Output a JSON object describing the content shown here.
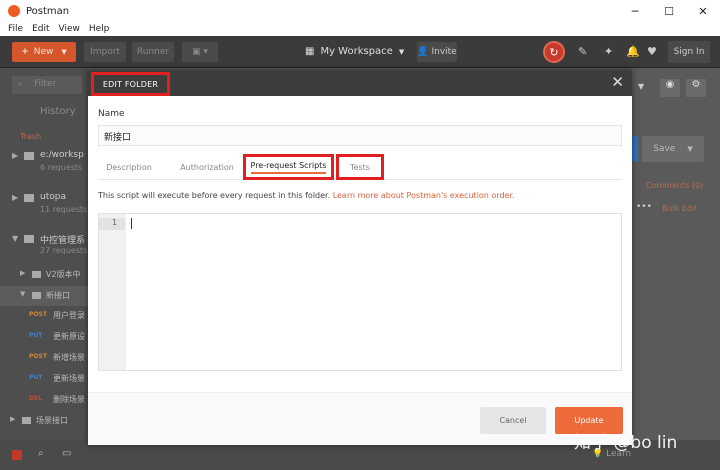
{
  "window": {
    "title": "Postman",
    "minimize": "─",
    "maximize": "☐",
    "close": "✕"
  },
  "menu": [
    "File",
    "Edit",
    "View",
    "Help"
  ],
  "toolbar": {
    "new_label": "New",
    "import_label": "Import",
    "runner_label": "Runner",
    "workspace_label": "My Workspace",
    "invite_label": "Invite",
    "signin_label": "Sign In"
  },
  "sidebar": {
    "filter_placeholder": "Filter",
    "history_tab": "History",
    "trash": "Trash",
    "collections": [
      {
        "name": "e:/worksp",
        "count": "6 requests"
      },
      {
        "name": "utopa",
        "count": "11 requests"
      },
      {
        "name": "中控管理系",
        "count": "27 requests"
      }
    ],
    "rows": [
      {
        "type": "folder",
        "name": "V2版本中"
      },
      {
        "type": "folder",
        "name": "新接口"
      },
      {
        "method": "POST",
        "name": "用户登录"
      },
      {
        "method": "PUT",
        "name": "更新原设"
      },
      {
        "method": "POST",
        "name": "新增场景"
      },
      {
        "method": "PUT",
        "name": "更新场景"
      },
      {
        "method": "DEL",
        "name": "删除场景"
      },
      {
        "type": "folder",
        "name": "场景接口"
      }
    ]
  },
  "right_pane": {
    "save_label": "Save",
    "comments_label": "Comments (0)",
    "bulk_edit_label": "Bulk Edit"
  },
  "bottom": {
    "learn_label": "Learn"
  },
  "watermark": "知乎 @bo lin",
  "modal": {
    "title": "EDIT FOLDER",
    "name_label": "Name",
    "name_value": "新接口",
    "tabs": [
      "Description",
      "Authorization",
      "Pre-request Scripts",
      "Tests"
    ],
    "active_tab": "Pre-request Scripts",
    "info_text": "This script will execute before every request in this folder.",
    "info_link": "Learn more about Postman's execution order.",
    "editor_line": "1",
    "cancel_label": "Cancel",
    "update_label": "Update"
  },
  "colors": {
    "accent": "#ef6a3a",
    "highlight": "#e02020",
    "toolbar_bg": "#3b3b3b",
    "modal_header": "#3c3c3c"
  }
}
